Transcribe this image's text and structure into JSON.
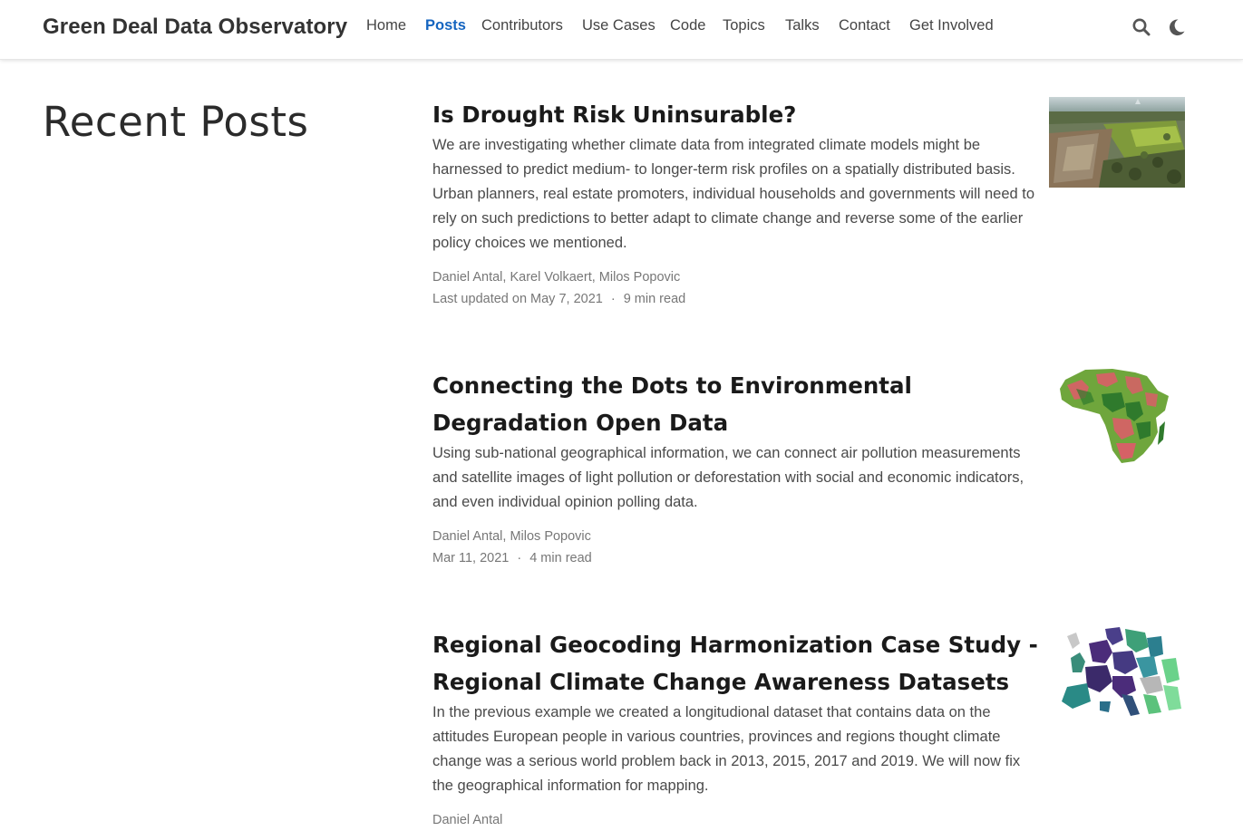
{
  "site": {
    "brand": "Green Deal Data Observatory"
  },
  "nav": {
    "items": [
      {
        "label": "Home",
        "active": false
      },
      {
        "label": "Posts",
        "active": true
      },
      {
        "label": "Contributors",
        "active": false
      },
      {
        "label": "Use Cases",
        "active": false
      },
      {
        "label": "Code",
        "active": false
      },
      {
        "label": "Topics",
        "active": false
      },
      {
        "label": "Talks",
        "active": false
      },
      {
        "label": "Contact",
        "active": false
      },
      {
        "label": "Get Involved",
        "active": false
      }
    ],
    "icons": [
      "search-icon",
      "moon-icon"
    ],
    "accent_color": "#1565c0"
  },
  "page": {
    "title": "Recent Posts"
  },
  "posts": [
    {
      "title": "Is Drought Risk Uninsurable?",
      "summary": "We are investigating whether climate data from integrated climate models might be harnessed to predict medium- to longer-term risk profiles on a spatially distributed basis. Urban planners, real estate promoters, individual households and governments will need to rely on such predictions to better adapt to climate change and reverse some of the earlier policy choices we mentioned.",
      "authors": [
        "Daniel Antal",
        "Karel Volkaert",
        "Milos Popovic"
      ],
      "date": "Last updated on May 7, 2021",
      "read_time": "9 min read",
      "thumb": "aerial-flooded-farmland-photo"
    },
    {
      "title": "Connecting the Dots to Environmental Degradation Open Data",
      "summary": "Using sub-national geographical information, we can connect air pollution measurements and satellite images of light pollution or deforestation with social and economic indicators, and even individual opinion polling data.",
      "authors": [
        "Daniel Antal",
        "Milos Popovic"
      ],
      "date": "Mar 11, 2021",
      "read_time": "4 min read",
      "thumb": "africa-deforestation-map"
    },
    {
      "title": "Regional Geocoding Harmonization Case Study - Regional Climate Change Awareness Datasets",
      "summary": "In the previous example we created a longitudional dataset that contains data on the attitudes European people in various countries, provinces and regions thought climate change was a serious world problem back in 2013, 2015, 2017 and 2019. We will now fix the geographical information for mapping.",
      "authors": [
        "Daniel Antal"
      ],
      "date": "",
      "read_time": "",
      "thumb": "europe-regional-map"
    }
  ]
}
